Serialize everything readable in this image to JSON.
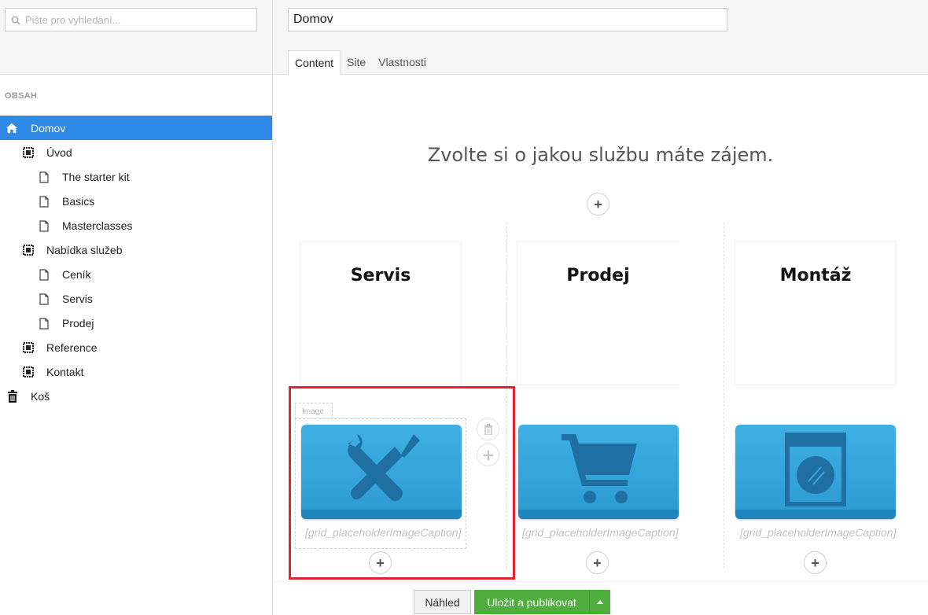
{
  "search": {
    "placeholder": "Pište pro vyhledání..."
  },
  "sidebar": {
    "section_label": "OBSAH",
    "items": [
      {
        "label": "Domov",
        "icon": "home-icon"
      },
      {
        "label": "Úvod",
        "icon": "grid-icon"
      },
      {
        "label": "The starter kit",
        "icon": "document-icon"
      },
      {
        "label": "Basics",
        "icon": "document-icon"
      },
      {
        "label": "Masterclasses",
        "icon": "document-icon"
      },
      {
        "label": "Nabídka služeb",
        "icon": "grid-icon"
      },
      {
        "label": "Ceník",
        "icon": "document-icon"
      },
      {
        "label": "Servis",
        "icon": "document-icon"
      },
      {
        "label": "Prodej",
        "icon": "document-icon"
      },
      {
        "label": "Reference",
        "icon": "grid-icon"
      },
      {
        "label": "Kontakt",
        "icon": "grid-icon"
      },
      {
        "label": "Koš",
        "icon": "trash-icon"
      }
    ],
    "active_color": "#2e8ae6"
  },
  "editor": {
    "name_value": "Domov",
    "tabs": [
      {
        "label": "Content"
      },
      {
        "label": "Site"
      },
      {
        "label": "Vlastnosti"
      }
    ]
  },
  "content": {
    "heading": "Zvolte si o jakou službu máte zájem.",
    "image_tag": "Image",
    "columns": [
      {
        "title": "Servis",
        "caption": "[grid_placeholderImageCaption]",
        "icon": "tools-icon"
      },
      {
        "title": "Prodej",
        "caption": "[grid_placeholderImageCaption]",
        "icon": "cart-icon"
      },
      {
        "title": "Montáž",
        "caption": "[grid_placeholderImageCaption]",
        "icon": "washing-machine-icon"
      }
    ],
    "add_symbol": "+"
  },
  "footer": {
    "preview_label": "Náhled",
    "save_label": "Uložit a publikovat",
    "save_color": "#4fae3d"
  }
}
